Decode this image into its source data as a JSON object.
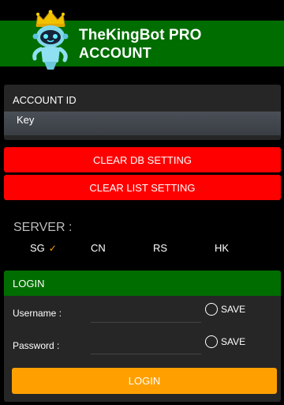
{
  "header": {
    "title": "TheKingBot PRO",
    "subtitle": "ACCOUNT",
    "logo_icon": "crowned-robot-logo-icon"
  },
  "account": {
    "label": "ACCOUNT ID",
    "key_placeholder": "Key",
    "key_value": ""
  },
  "buttons": {
    "clear_db": "CLEAR DB SETTING",
    "clear_list": "CLEAR LIST SETTING"
  },
  "server": {
    "label": "SERVER :",
    "options": [
      {
        "label": "SG",
        "selected": true
      },
      {
        "label": "CN",
        "selected": false
      },
      {
        "label": "RS",
        "selected": false
      },
      {
        "label": "HK",
        "selected": false
      }
    ],
    "check_mark": "✓"
  },
  "login": {
    "title": "LOGIN",
    "username_label": "Username :",
    "username_value": "",
    "password_label": "Password :",
    "password_value": "",
    "save_label": "SAVE",
    "username_save_checked": false,
    "password_save_checked": false,
    "submit_label": "LOGIN"
  },
  "colors": {
    "header_green": "#006d00",
    "danger_red": "#ff0000",
    "login_orange": "#ffa000",
    "check_orange": "#f5a000",
    "panel_bg": "#262626"
  }
}
